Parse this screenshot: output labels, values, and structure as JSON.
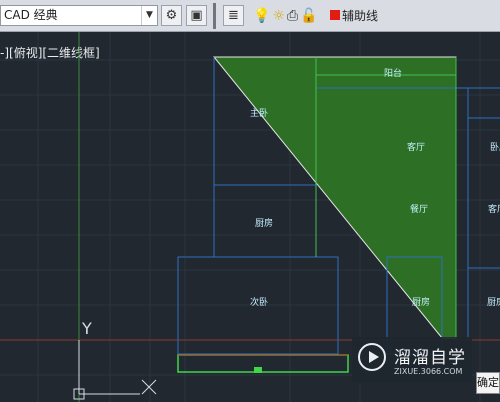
{
  "toolbar": {
    "workspace_value": "CAD 经典",
    "layer_name": "辅助线",
    "layer_color": "#e21b13"
  },
  "viewport": {
    "label": "-][俯视][二维线框]"
  },
  "drawing": {
    "rooms": [
      "阳台",
      "主卧",
      "客厅",
      "餐厅",
      "厨房",
      "次卧",
      "卧厅",
      "客厅",
      "厨房",
      "厨房"
    ],
    "ucs_y": "Y"
  },
  "watermark": {
    "title": "溜溜自学",
    "url": "ZIXUE.3066.COM"
  },
  "corner_badge": "确定"
}
